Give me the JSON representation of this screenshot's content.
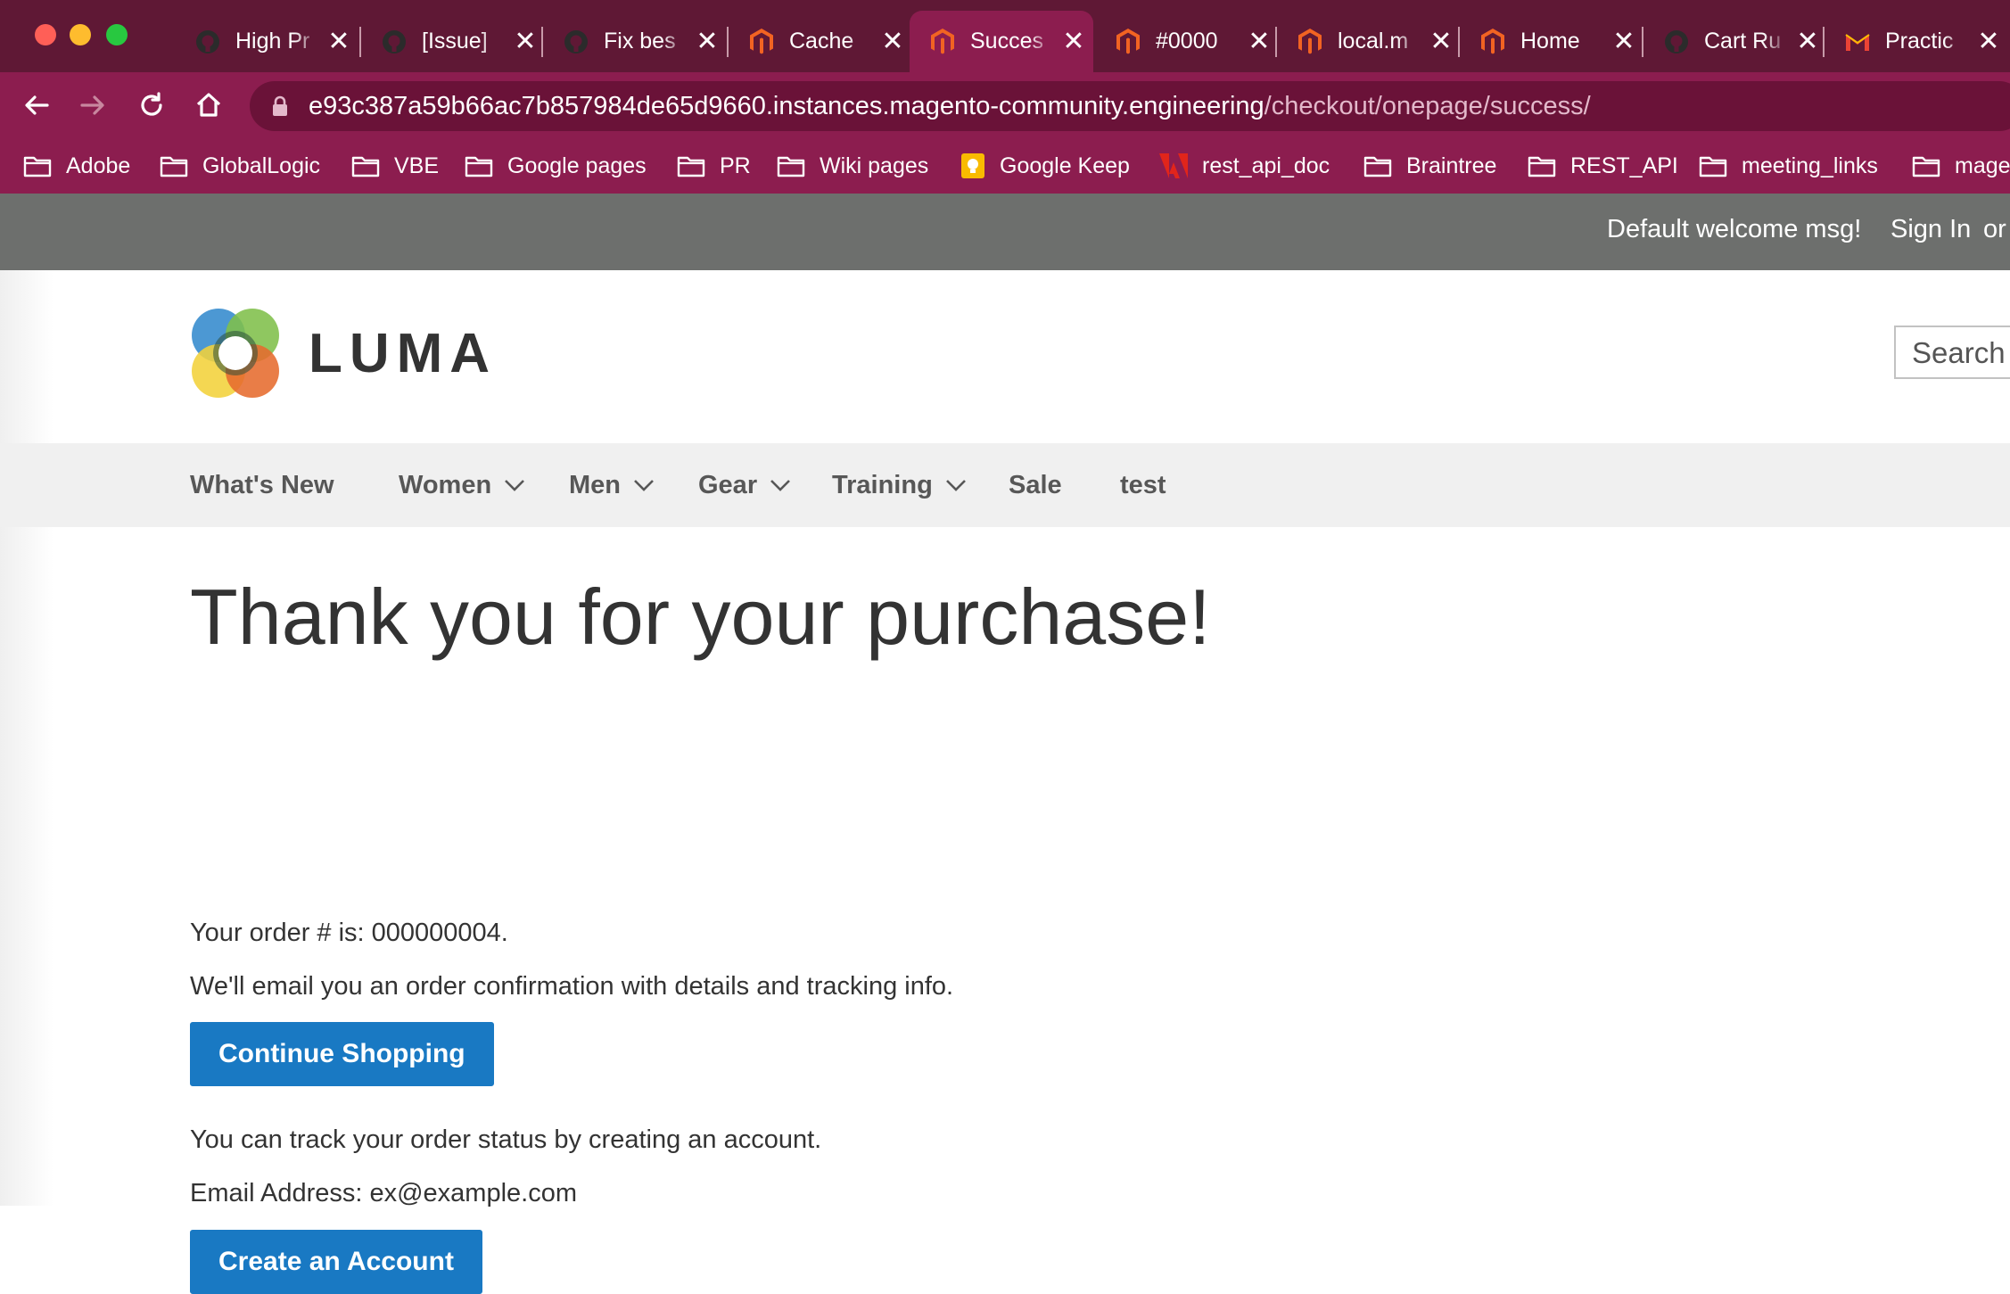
{
  "browser": {
    "tabs": [
      {
        "title": "High Pr",
        "icon": "github-icon"
      },
      {
        "title": "[Issue]",
        "icon": "github-icon"
      },
      {
        "title": "Fix bes",
        "icon": "github-icon"
      },
      {
        "title": "Cache",
        "icon": "magento-icon"
      },
      {
        "title": "Succes",
        "icon": "magento-icon",
        "active": true
      },
      {
        "title": "#0000",
        "icon": "magento-icon"
      },
      {
        "title": "local.m",
        "icon": "magento-icon"
      },
      {
        "title": "Home",
        "icon": "magento-icon"
      },
      {
        "title": "Cart Ru",
        "icon": "github-icon"
      },
      {
        "title": "Practic",
        "icon": "gmail-icon"
      }
    ],
    "url_host": "e93c387a59b66ac7b857984de65d9660.instances.magento-community.engineering",
    "url_path": "/checkout/onepage/success/",
    "bookmarks": [
      {
        "label": "Adobe",
        "icon": "folder-icon"
      },
      {
        "label": "GlobalLogic",
        "icon": "folder-icon"
      },
      {
        "label": "VBE",
        "icon": "folder-icon"
      },
      {
        "label": "Google pages",
        "icon": "folder-icon"
      },
      {
        "label": "PR",
        "icon": "folder-icon"
      },
      {
        "label": "Wiki pages",
        "icon": "folder-icon"
      },
      {
        "label": "Google Keep",
        "icon": "google-keep-icon"
      },
      {
        "label": "rest_api_doc",
        "icon": "adobe-icon"
      },
      {
        "label": "Braintree",
        "icon": "folder-icon"
      },
      {
        "label": "REST_API",
        "icon": "folder-icon"
      },
      {
        "label": "meeting_links",
        "icon": "folder-icon"
      },
      {
        "label": "mage",
        "icon": "folder-icon"
      }
    ]
  },
  "header": {
    "welcome": "Default welcome msg!",
    "sign_in": "Sign In",
    "or": "or",
    "logo_text": "LUMA",
    "search_placeholder": "Search"
  },
  "nav": {
    "items": [
      {
        "label": "What's New",
        "has_submenu": false
      },
      {
        "label": "Women",
        "has_submenu": true
      },
      {
        "label": "Men",
        "has_submenu": true
      },
      {
        "label": "Gear",
        "has_submenu": true
      },
      {
        "label": "Training",
        "has_submenu": true
      },
      {
        "label": "Sale",
        "has_submenu": false
      },
      {
        "label": "test",
        "has_submenu": false
      }
    ]
  },
  "main": {
    "title": "Thank you for your purchase!",
    "order_line": "Your order # is: 000000004.",
    "email_note": "We'll email you an order confirmation with details and tracking info.",
    "continue_label": "Continue Shopping",
    "track_note": "You can track your order status by creating an account.",
    "email_line": "Email Address: ex@example.com",
    "create_account_label": "Create an Account"
  },
  "colors": {
    "tabbar": "#5f1835",
    "toolbar": "#8c1d4f",
    "panel_header": "#6d6f6d",
    "nav_bg": "#f0f0f0",
    "button": "#1979c3"
  }
}
